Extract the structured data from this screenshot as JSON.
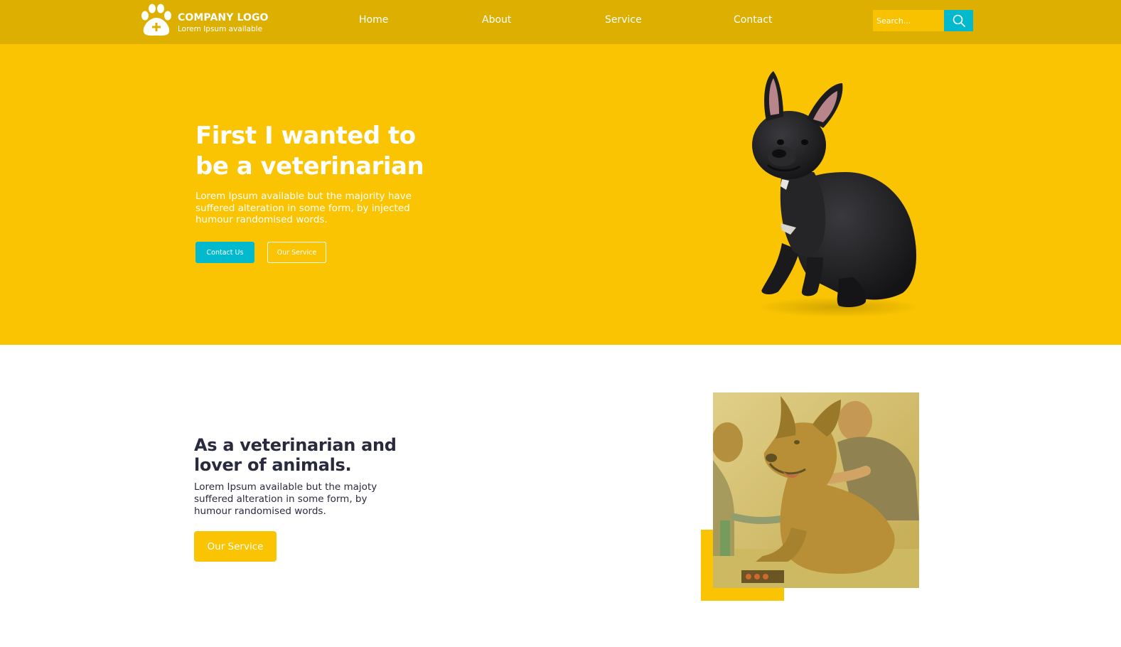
{
  "header": {
    "logo_title": "COMPANY LOGO",
    "logo_subtitle": "Lorem Ipsum available",
    "logo_icon": "paw-plus-icon",
    "nav": [
      "Home",
      "About",
      "Service",
      "Contact"
    ],
    "search_placeholder": "Search...",
    "search_icon": "search-icon"
  },
  "hero": {
    "title": "First I wanted to be a veterinarian",
    "text": "Lorem Ipsum available but the majority have suffered alteration in some form, by injected humour randomised words.",
    "contact_button": "Contact Us",
    "service_button": "Our Service",
    "image": "french-bulldog"
  },
  "section2": {
    "title": "As a veterinarian and lover of animals.",
    "text": "Lorem Ipsum available but the majoty suffered alteration in some form, by humour randomised words.",
    "button": "Our Service",
    "image": "vets-examining-german-shepherd"
  },
  "colors": {
    "header_bg": "#dcaf00",
    "hero_bg": "#fac402",
    "accent_teal": "#03b9cd",
    "heading_dark": "#2a2a3e"
  }
}
